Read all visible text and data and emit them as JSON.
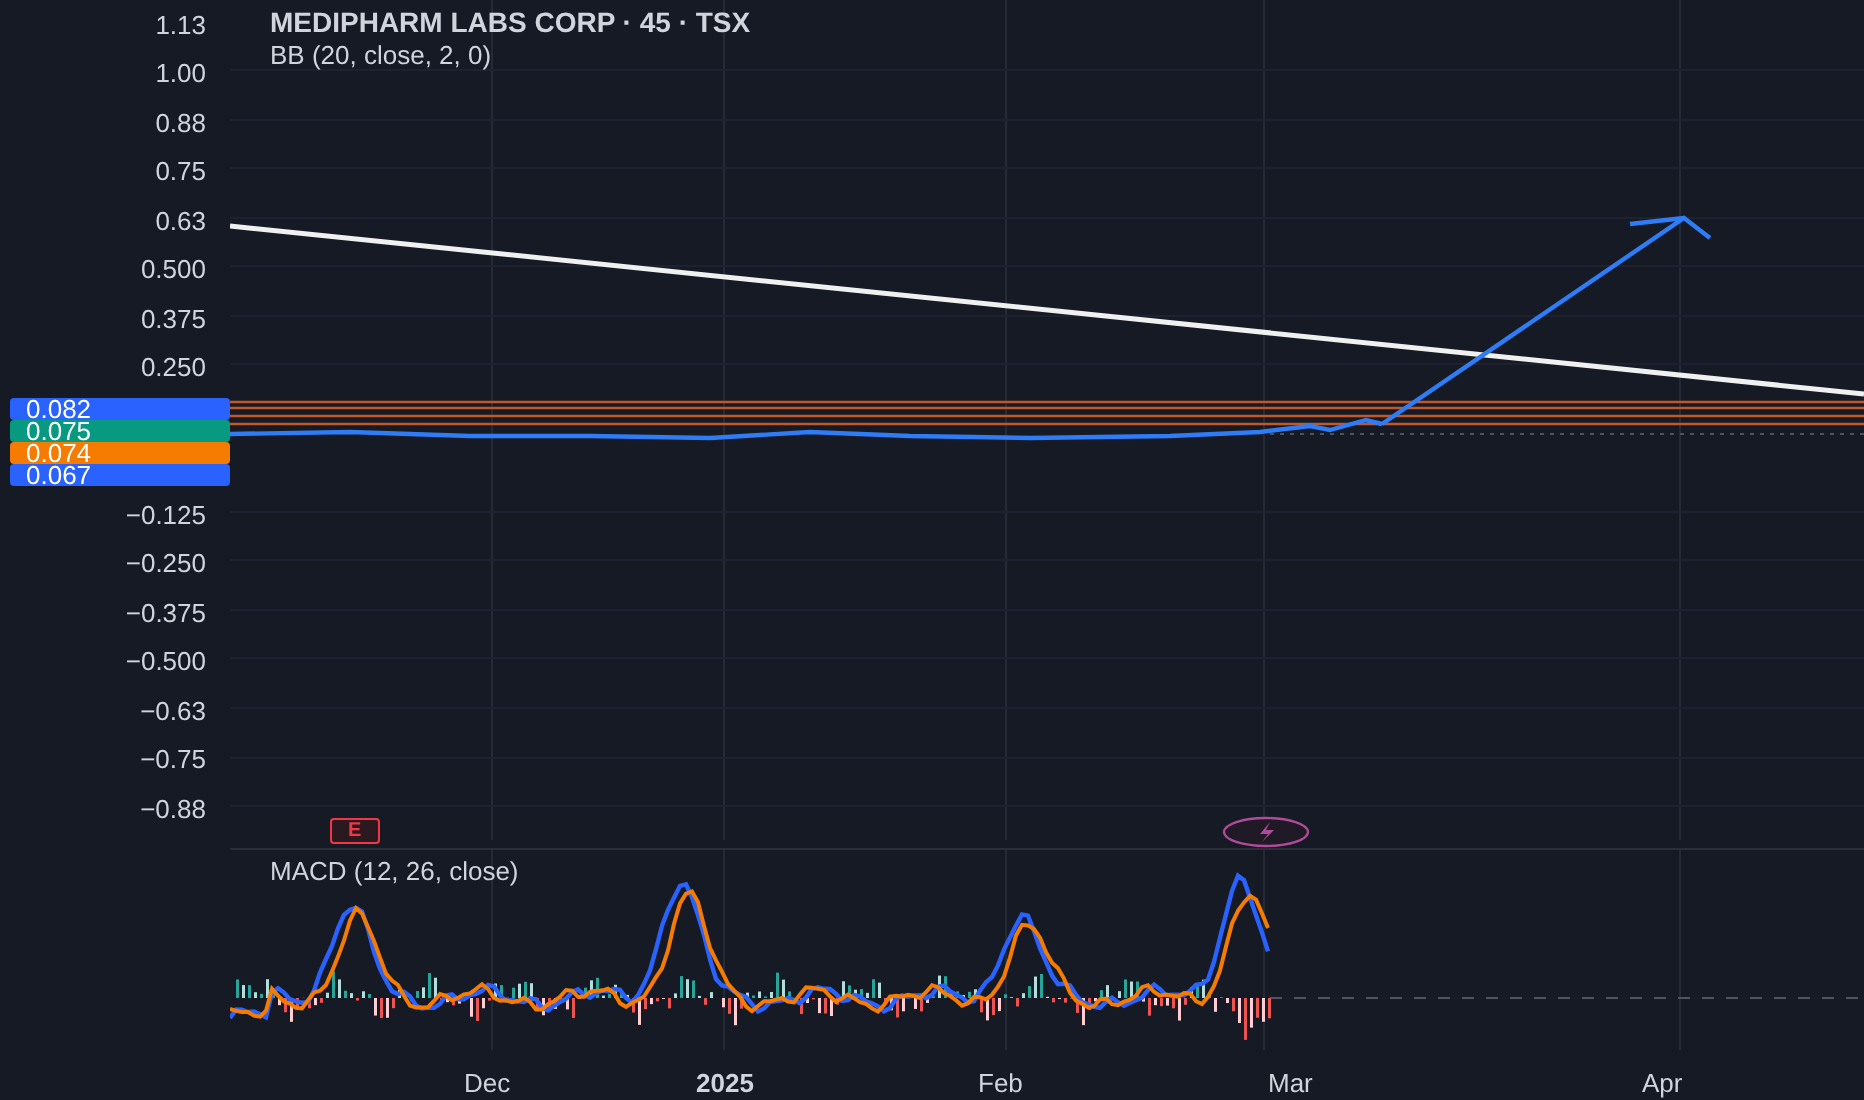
{
  "chart": {
    "title": "MEDIPHARM LABS CORP · 45 · TSX",
    "indicator": "BB (20, close, 2, 0)"
  },
  "price_axis": {
    "upper_labels": [
      "1.13",
      "1.00",
      "0.88",
      "0.75",
      "0.63",
      "0.500",
      "0.375",
      "0.250"
    ],
    "lower_labels": [
      "−0.125",
      "−0.250",
      "−0.375",
      "−0.500",
      "−0.63",
      "−0.75",
      "−0.88"
    ]
  },
  "price_badges": [
    {
      "text": "0.082",
      "color": "#2962ff"
    },
    {
      "text": "0.075",
      "color": "#089981"
    },
    {
      "text": "0.074",
      "color": "#f57c00"
    },
    {
      "text": "0.067",
      "color": "#2962ff"
    }
  ],
  "events": [
    {
      "kind": "earnings",
      "label": "E"
    },
    {
      "kind": "split"
    }
  ],
  "macd": {
    "title": "MACD (12, 26, close)"
  },
  "time_axis": [
    {
      "label": "Dec",
      "bold": false
    },
    {
      "label": "2025",
      "bold": true
    },
    {
      "label": "Feb",
      "bold": false
    },
    {
      "label": "Mar",
      "bold": false
    },
    {
      "label": "Apr",
      "bold": false
    }
  ]
}
